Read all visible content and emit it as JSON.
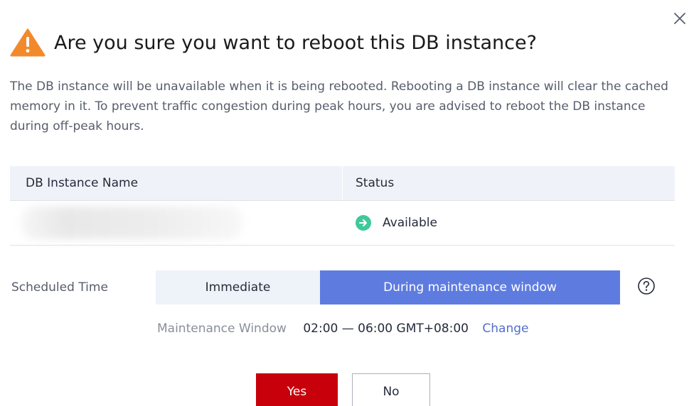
{
  "dialog": {
    "title": "Are you sure you want to reboot this DB instance?",
    "description": "The DB instance will be unavailable when it is being rebooted. Rebooting a DB instance will clear the cached memory in it. To prevent traffic congestion during peak hours, you are advised to reboot the DB instance during off-peak hours.",
    "icons": {
      "warning": "warning-triangle-icon",
      "close": "close-icon",
      "status": "arrow-right-circle-icon",
      "help": "question-circle-icon"
    },
    "colors": {
      "warning": "#f28a2c",
      "status_available": "#3ec99c",
      "primary_segment": "#5e7ce0",
      "danger_button": "#c7000b",
      "link": "#526ecc"
    }
  },
  "table": {
    "headers": [
      "DB Instance Name",
      "Status"
    ],
    "rows": [
      {
        "name": "",
        "status": "Available"
      }
    ]
  },
  "schedule": {
    "label": "Scheduled Time",
    "options": [
      "Immediate",
      "During maintenance window"
    ],
    "selected": "During maintenance window",
    "maintenance_label": "Maintenance Window",
    "maintenance_value": "02:00 — 06:00 GMT+08:00",
    "change_link": "Change"
  },
  "buttons": {
    "yes": "Yes",
    "no": "No"
  }
}
